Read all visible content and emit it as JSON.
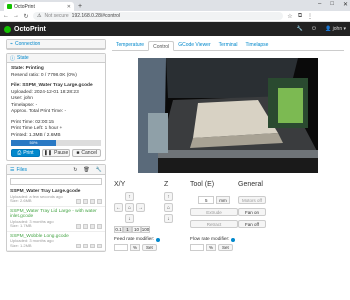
{
  "browser": {
    "tab_title": "OctoPrint",
    "new_tab": "+",
    "url_secure": "Not secure",
    "url": "192.168.0.28/#control",
    "win_min": "–",
    "win_max": "□",
    "win_close": "✕"
  },
  "navbar": {
    "brand": "OctoPrint",
    "user": "john",
    "user_caret": "▾"
  },
  "connection": {
    "title": "Connection"
  },
  "state": {
    "title": "State",
    "state_line": "State: Printing",
    "resend": "Resend ratio: 0 / 7798.0K (0%)",
    "file": "File: SSPM_Water Tray Large.gcode",
    "uploaded": "Uploaded: 2024-12-01 18:28:23",
    "user": "User: john",
    "timelapse": "Timelapse: -",
    "approx": "Approx. Total Print Time: -",
    "print_time": "Print Time: 02:00:15",
    "print_left": "Print Time Left: 1 hour +",
    "printed": "Printed: 1.3MB / 2.6MB",
    "progress_label": "50%",
    "progress": 0.5,
    "btn_print": "Print",
    "btn_pause": "Pause",
    "btn_cancel": "Cancel"
  },
  "files": {
    "title": "Files",
    "list": [
      {
        "name": "SSPM_Water Tray Large.gcode",
        "meta1": "Uploaded: a few seconds ago",
        "meta2": "Size: 2.6MB",
        "style": "bold"
      },
      {
        "name": "SSPM_Water Tray Lid Large - with water inlet.gcode",
        "meta1": "Uploaded: 3 months ago",
        "meta2": "Size: 1.7MB",
        "style": "green"
      },
      {
        "name": "SSPM_Wobble Long.gcode",
        "meta1": "Uploaded: 3 months ago",
        "meta2": "Size: 1.2MB",
        "style": "green"
      }
    ]
  },
  "tabs": [
    "Temperature",
    "Control",
    "GCode Viewer",
    "Terminal",
    "Timelapse"
  ],
  "control": {
    "xy_label": "X/Y",
    "z_label": "Z",
    "tool_label": "Tool (E)",
    "general_label": "General",
    "steps": [
      "0.1",
      "1",
      "10",
      "100"
    ],
    "tool_amount": "5",
    "tool_unit": "mm",
    "extrude": "Extrude",
    "retract": "Retract",
    "motors_off": "Motors off",
    "fan_on": "Fan on",
    "fan_off": "Fan off",
    "feed_label": "Feed rate modifier:",
    "flow_label": "Flow rate modifier:",
    "pct": "%",
    "set": "Set"
  }
}
